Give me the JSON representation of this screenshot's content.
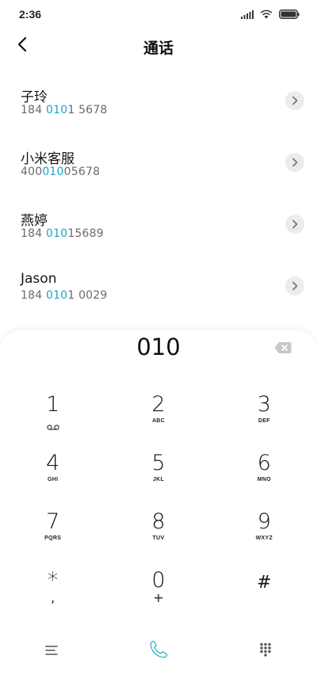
{
  "status_bar": {
    "time": "2:36"
  },
  "header": {
    "title": "通话",
    "back_icon": "chevron-left-icon"
  },
  "contacts": [
    {
      "name": "子玲",
      "number_parts": [
        "184 ",
        "010",
        "1 5678"
      ]
    },
    {
      "name": "小米客服",
      "number_parts": [
        "400",
        "010",
        "05678"
      ]
    },
    {
      "name": "燕婷",
      "number_parts": [
        "184 ",
        "010",
        "15689"
      ]
    },
    {
      "name": "Jason",
      "number_parts": [
        "184 ",
        "010",
        "1 0029"
      ]
    }
  ],
  "dialer": {
    "input_value": "010",
    "keys": [
      {
        "digit": "1",
        "sub": "voicemail-icon"
      },
      {
        "digit": "2",
        "sub": "ABC"
      },
      {
        "digit": "3",
        "sub": "DEF"
      },
      {
        "digit": "4",
        "sub": "GHI"
      },
      {
        "digit": "5",
        "sub": "JKL"
      },
      {
        "digit": "6",
        "sub": "MNO"
      },
      {
        "digit": "7",
        "sub": "PQRS"
      },
      {
        "digit": "8",
        "sub": "TUV"
      },
      {
        "digit": "9",
        "sub": "WXYZ"
      },
      {
        "digit": "*",
        "sub": ","
      },
      {
        "digit": "0",
        "sub": "+"
      },
      {
        "digit": "#",
        "sub": ""
      }
    ]
  },
  "colors": {
    "highlight": "#1aa6c7",
    "text_primary": "#111111",
    "text_secondary": "#6b6b6b",
    "call_icon": "#3bb7c9"
  },
  "bottom_bar": {
    "menu_icon": "menu-lines-icon",
    "call_icon": "phone-handset-icon",
    "dialpad_icon": "dialpad-grid-icon"
  }
}
